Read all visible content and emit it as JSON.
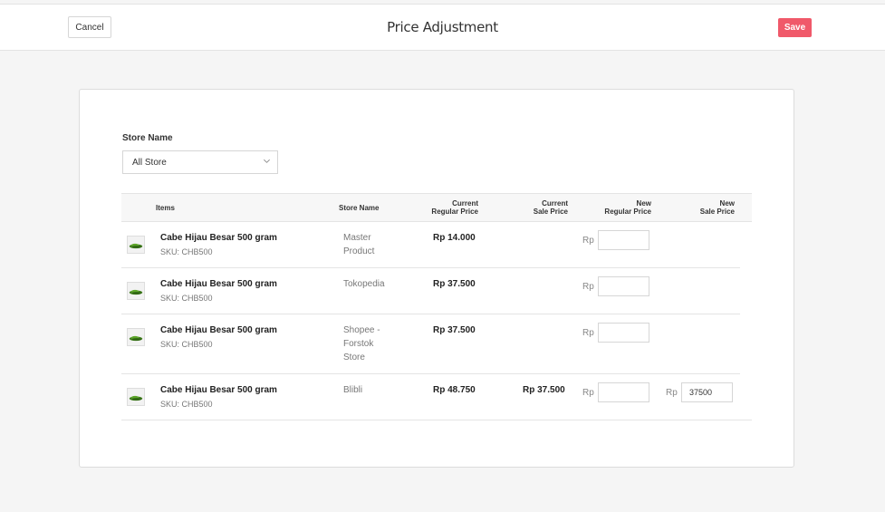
{
  "header": {
    "cancel_label": "Cancel",
    "title": "Price Adjustment",
    "save_label": "Save"
  },
  "filter": {
    "label": "Store Name",
    "selected": "All Store"
  },
  "table": {
    "headers": {
      "items": "Items",
      "store_name": "Store Name",
      "current_regular_1": "Current",
      "current_regular_2": "Regular Price",
      "current_sale_1": "Current",
      "current_sale_2": "Sale Price",
      "new_regular_1": "New",
      "new_regular_2": "Regular Price",
      "new_sale_1": "New",
      "new_sale_2": "Sale Price"
    },
    "currency": "Rp",
    "rows": [
      {
        "name": "Cabe Hijau Besar 500 gram",
        "sku": "SKU: CHB500",
        "store": "Master Product",
        "regular_price": "Rp 14.000",
        "sale_price": "",
        "new_regular": "",
        "new_sale": ""
      },
      {
        "name": "Cabe Hijau Besar 500 gram",
        "sku": "SKU: CHB500",
        "store": "Tokopedia",
        "regular_price": "Rp 37.500",
        "sale_price": "",
        "new_regular": "",
        "new_sale": ""
      },
      {
        "name": "Cabe Hijau Besar 500 gram",
        "sku": "SKU: CHB500",
        "store": "Shopee - Forstok Store",
        "regular_price": "Rp 37.500",
        "sale_price": "",
        "new_regular": "",
        "new_sale": ""
      },
      {
        "name": "Cabe Hijau Besar 500 gram",
        "sku": "SKU: CHB500",
        "store": "Blibli",
        "regular_price": "Rp 48.750",
        "sale_price": "Rp 37.500",
        "new_regular": "",
        "new_sale": "37500"
      }
    ]
  },
  "colors": {
    "save_button": "#f0596a",
    "background": "#f5f5f5",
    "card": "#ffffff"
  }
}
